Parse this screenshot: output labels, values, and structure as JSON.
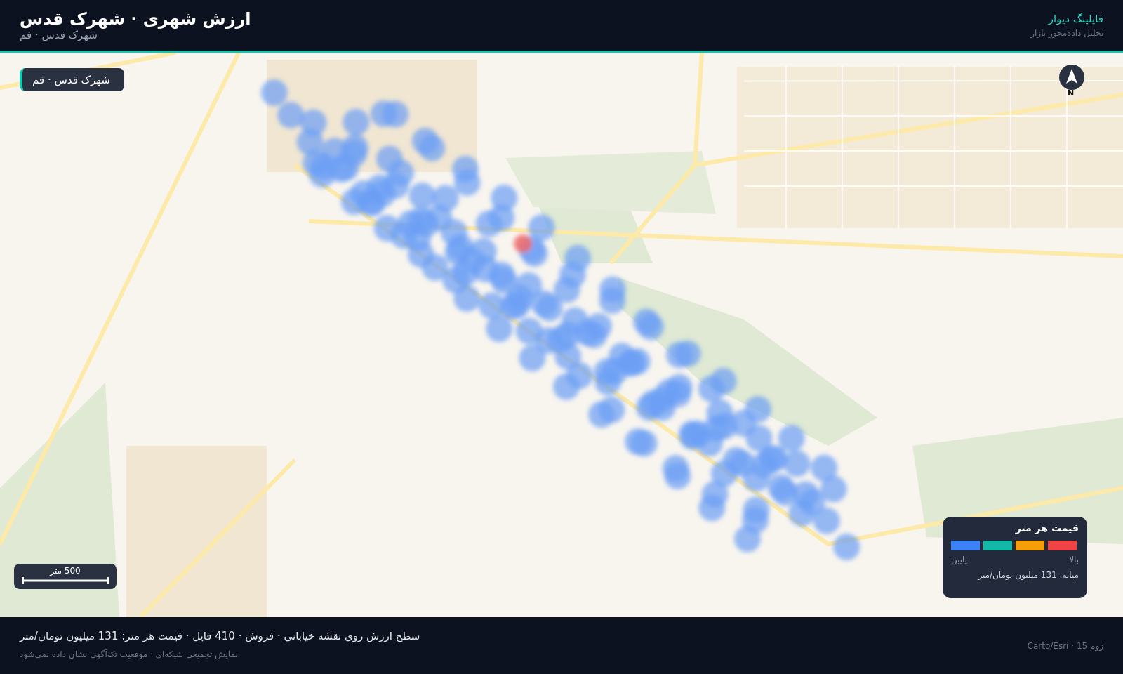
{
  "header": {
    "title": "ارزش شهری · شهرک قدس",
    "subtitle": "شهرک قدس · قم",
    "brand": "فایلینگ دیوار",
    "tagline": "تحلیل داده‌محور بازار"
  },
  "map": {
    "location_badge": "شهرک قدس · قم",
    "north_label": "N",
    "scale_label": "500 متر"
  },
  "legend": {
    "title": "قیمت هر متر",
    "swatches": [
      {
        "color": "#3b82f6"
      },
      {
        "color": "#14b8a6"
      },
      {
        "color": "#f59e0b"
      },
      {
        "color": "#ef4444"
      }
    ],
    "low_label": "پایین",
    "high_label": "بالا",
    "median": "میانه: 131 میلیون تومان/متر"
  },
  "footer": {
    "summary": "سطح ارزش روی نقشه خیابانی · فروش · 410 فایل · قیمت هر متر: 131 میلیون تومان/متر",
    "note": "نمایش تجمیعی شبکه‌ای · موقعیت تک‌آگهی نشان داده نمی‌شود",
    "attribution": "Carto/Esri · 15 زوم"
  }
}
